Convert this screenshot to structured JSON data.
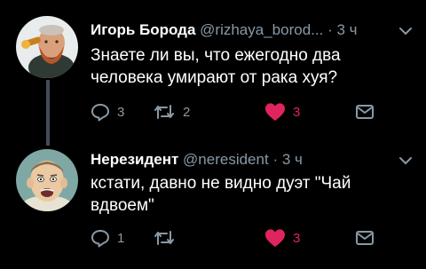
{
  "colors": {
    "background": "#000000",
    "name": "#ffffff",
    "text": "#ffffff",
    "muted": "#8899a6",
    "like": "#e0245e",
    "thread_line": "#444c54"
  },
  "tweets": [
    {
      "name": "Игорь Борода",
      "handle": "@rizhaya_borod...",
      "dot": "·",
      "time": "3 ч",
      "text": "Знаете ли вы, что ежегодно два человека умирают от рака хуя?",
      "reply_count": "3",
      "retweet_count": "2",
      "like_count": "3",
      "liked": true,
      "icons": [
        "reply-icon",
        "retweet-icon",
        "heart-icon",
        "envelope-icon",
        "chevron-down-icon"
      ]
    },
    {
      "name": "Нерезидент",
      "handle": "@neresident",
      "dot": "·",
      "time": "3 ч",
      "text": "кстати, давно не видно дуэт \"Чай вдвоем\"",
      "reply_count": "1",
      "retweet_count": "",
      "like_count": "3",
      "liked": true,
      "icons": [
        "reply-icon",
        "retweet-icon",
        "heart-icon",
        "envelope-icon",
        "chevron-down-icon"
      ]
    }
  ]
}
